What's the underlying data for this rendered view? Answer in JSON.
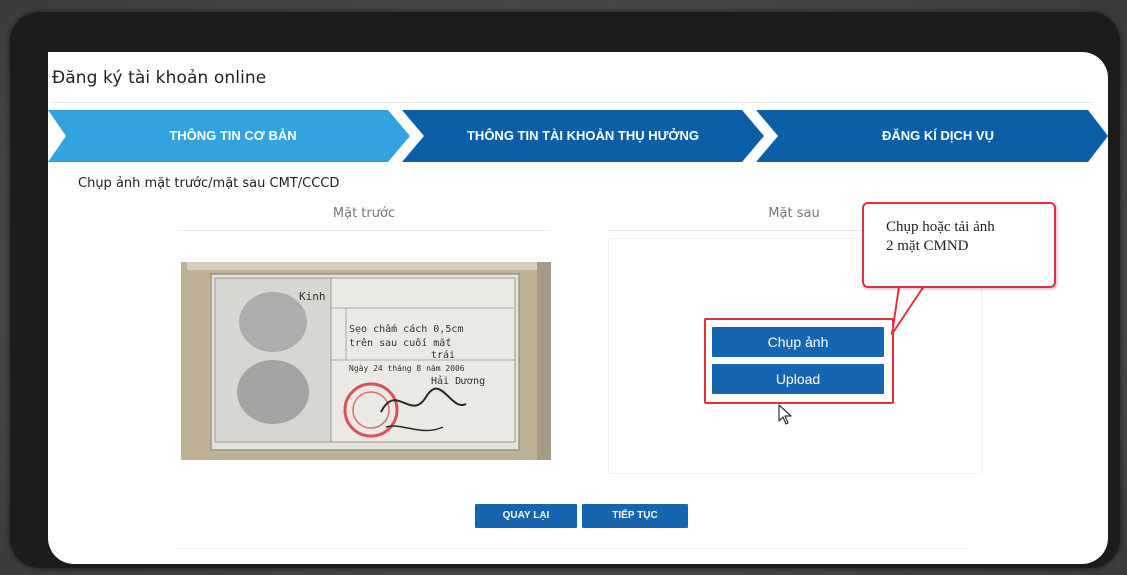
{
  "page_title": "Đăng ký tài khoản online",
  "steps": [
    {
      "label": "THÔNG TIN CƠ BẢN",
      "state": "active",
      "color": "#33a3e0"
    },
    {
      "label": "THÔNG TIN TÀI KHOẢN THỤ HƯỞNG",
      "state": "inactive",
      "color": "#0b5fa8"
    },
    {
      "label": "ĐĂNG KÍ DỊCH VỤ",
      "state": "inactive",
      "color": "#0b5fa8"
    }
  ],
  "section_label": "Chụp ảnh mặt trước/mặt sau CMT/CCCD",
  "front": {
    "title": "Mặt trước",
    "card_text": {
      "line1": "Kinh",
      "line2": "Sẹo chấm cách 0,5cm",
      "line3": "trên sau cuối mắt",
      "line4": "trái",
      "line5": "Ngày 24 tháng 8 năm 2006",
      "line6": "Hải Dương"
    }
  },
  "back": {
    "title": "Mặt sau",
    "capture_label": "Chụp ảnh",
    "upload_label": "Upload"
  },
  "callout": {
    "line1": "Chụp hoặc tải ảnh",
    "line2": "2 mặt CMND",
    "border_color": "#e0323a"
  },
  "nav": {
    "back_label": "QUAY LẠI",
    "next_label": "TIẾP TỤC"
  },
  "colors": {
    "primary": "#1565b0",
    "active_step": "#33a3e0",
    "highlight": "#e0323a"
  }
}
